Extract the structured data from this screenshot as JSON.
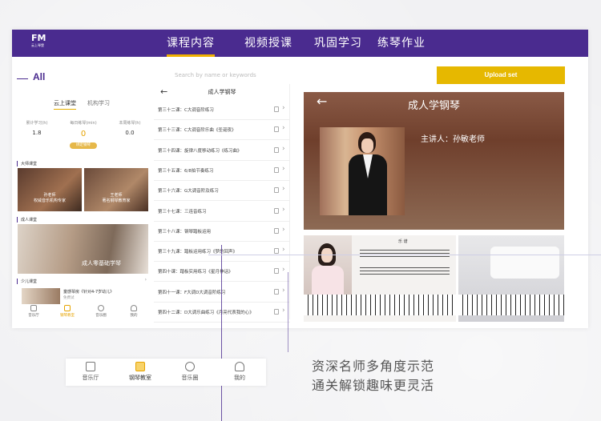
{
  "brand": {
    "logo_text": "FM",
    "logo_sub": "云上琴堡"
  },
  "nav": {
    "tabs": [
      {
        "label": "课程内容",
        "active": true
      },
      {
        "label": "视频授课"
      },
      {
        "label": "巩固学习"
      },
      {
        "label": "练琴作业"
      }
    ]
  },
  "left": {
    "all_label": "All",
    "segments": [
      "云上课堂",
      "机构学习"
    ],
    "stats": [
      {
        "label": "累计学习(h)",
        "value": "1.8"
      },
      {
        "label": "每日练琴(min)",
        "value": "0"
      },
      {
        "label": "本周练琴(h)",
        "value": "0.0"
      }
    ],
    "bind_button": "绑定钢琴",
    "sections": {
      "masters": "大师课堂",
      "adult": "成人课堂",
      "kids": "少儿课堂"
    },
    "masters_caption_1": "孙老师\n权威音乐机构专家",
    "masters_caption_2": "王老师\n著名钢琴教育家",
    "adult_caption": "成人零基础学琴",
    "kid_item_title": "童感琴房《针对4-7岁幼儿》",
    "kid_item_sub": "免费试",
    "bottom_tabs": [
      "音乐厅",
      "钢琴教室",
      "音乐圈",
      "我的"
    ]
  },
  "search": {
    "placeholder": "Search by name or keywords"
  },
  "upload_button": "Upload set",
  "course_list": {
    "title": "成人学钢琴",
    "lessons": [
      "第三十二课：C大调音阶练习",
      "第三十三课：C大调音阶乐曲《圣诞夜》",
      "第三十四课：旋律八度移动练习《练习曲》",
      "第三十五课：6/8拍节奏练习",
      "第三十六课：G大调音阶及练习",
      "第三十七课：三连音练习",
      "第三十八课：钢琴踏板运用",
      "第三十九课：踏板运用练习《梦的回声》",
      "第四十课：踏板实用练习《星月神话》",
      "第四十一课：F大调D大调音阶练习",
      "第四十二课：D大调乐曲练习《月亮代表我的心》"
    ]
  },
  "video": {
    "title": "成人学钢琴",
    "teacher": "主讲人：孙敏老师",
    "sheet_title": "乐 谱"
  },
  "tabbar": {
    "items": [
      {
        "label": "音乐厅"
      },
      {
        "label": "钢琴教室",
        "active": true
      },
      {
        "label": "音乐圈"
      },
      {
        "label": "我的"
      }
    ]
  },
  "slogan": {
    "line1": "资深名师多角度示范",
    "line2": "通关解锁趣味更灵活"
  },
  "colors": {
    "primary": "#4a2b8f",
    "accent": "#e6b800"
  }
}
